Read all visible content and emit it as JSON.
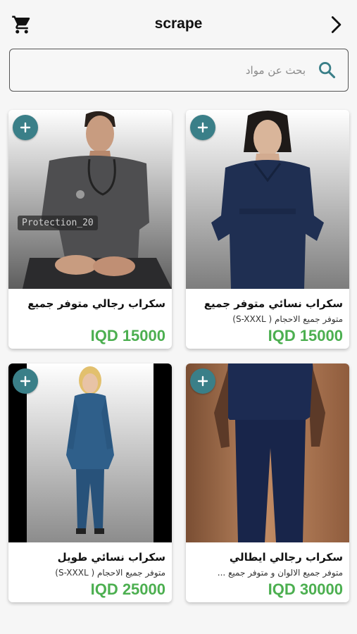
{
  "header": {
    "title": "scrape",
    "cart_icon": "cart-icon",
    "back_icon": "chevron-right-icon"
  },
  "search": {
    "placeholder": "بحث عن مواد",
    "icon": "search-icon"
  },
  "colors": {
    "accent": "#3a7f88",
    "price": "#4caf50"
  },
  "products": [
    {
      "name": "سكراب نسائي متوفر جميع",
      "description": "متوفر جميع الاحجام ( S-XXXL)",
      "price": "IQD 15000"
    },
    {
      "name": "سكراب رجالي متوفر جميع",
      "description": "",
      "price": "IQD 15000",
      "watermark": "Protection_20"
    },
    {
      "name": "سكراب رجالي ايطالي",
      "description": "متوفر جميع الالوان و متوفر جميع ...",
      "price": "IQD 30000"
    },
    {
      "name": "سكراب نسائي طويل",
      "description": "متوفر جميع الاحجام ( S-XXXL)",
      "price": "IQD 25000"
    }
  ]
}
